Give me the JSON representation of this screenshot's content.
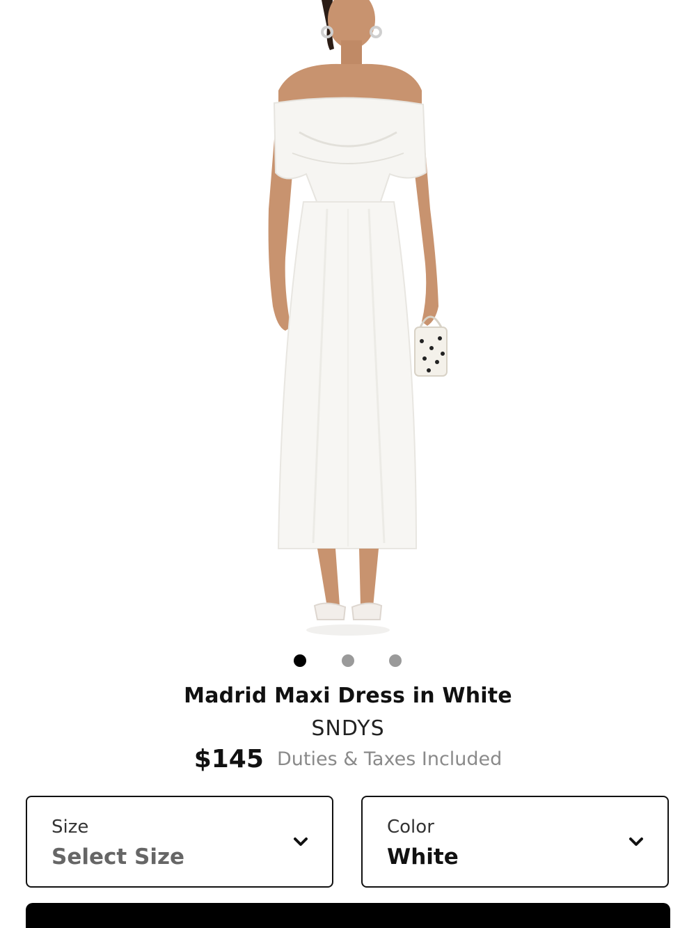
{
  "product": {
    "image_alt": "Model wearing white off-shoulder maxi dress",
    "title": "Madrid Maxi Dress in White",
    "brand": "SNDYS",
    "price": "$145",
    "price_note": "Duties & Taxes Included"
  },
  "carousel": {
    "count": 3,
    "active_index": 0
  },
  "selectors": {
    "size": {
      "label": "Size",
      "value": "Select Size",
      "icon": "chevron-down-icon"
    },
    "color": {
      "label": "Color",
      "value": "White",
      "icon": "chevron-down-icon"
    }
  },
  "colors": {
    "accent": "#000000",
    "muted_text": "#8a8a8a",
    "dot_inactive": "#9a9a9a"
  }
}
